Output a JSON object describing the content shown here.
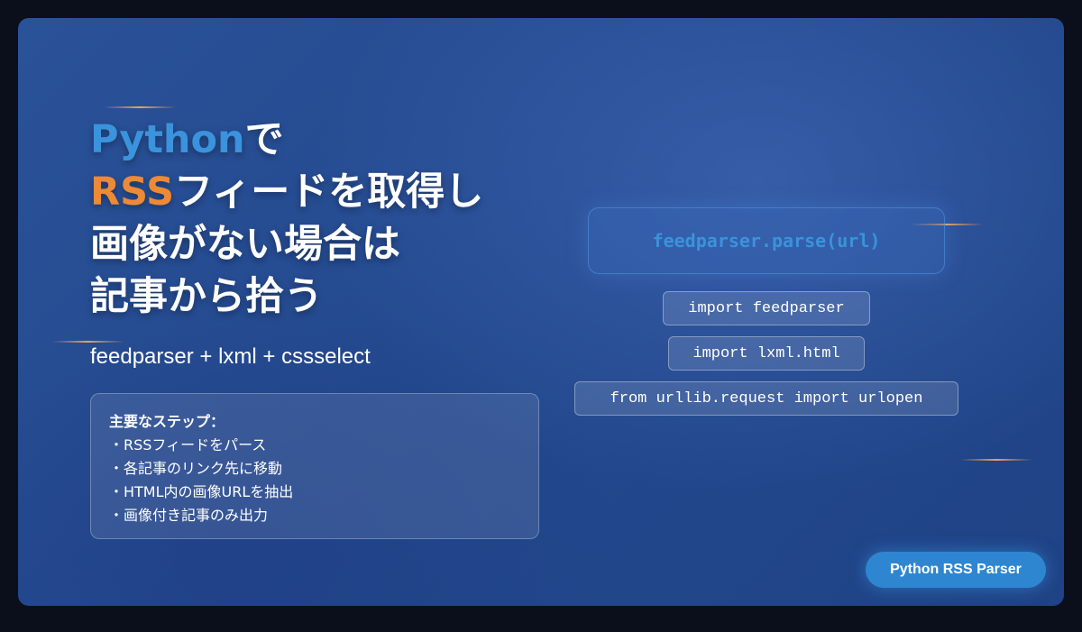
{
  "title": {
    "line1_highlight": "Python",
    "line1_rest": "で",
    "line2_highlight": "RSS",
    "line2_rest": "フィードを取得し",
    "line3": "画像がない場合は",
    "line4": "記事から拾う"
  },
  "subtitle": "feedparser + lxml + cssselect",
  "steps": {
    "heading": "主要なステップ：",
    "items": [
      "・RSSフィードをパース",
      "・各記事のリンク先に移動",
      "・HTML内の画像URLを抽出",
      "・画像付き記事のみ出力"
    ]
  },
  "code": {
    "main": "feedparser.parse(url)",
    "lines": [
      "import feedparser",
      "import lxml.html",
      "from urllib.request import urlopen"
    ]
  },
  "badge": "Python RSS Parser",
  "colors": {
    "background": "#0b0f1c",
    "card": "#2a5298",
    "accent_blue": "#3a93dc",
    "accent_orange": "#ec8a35",
    "badge": "#2f86d0"
  }
}
